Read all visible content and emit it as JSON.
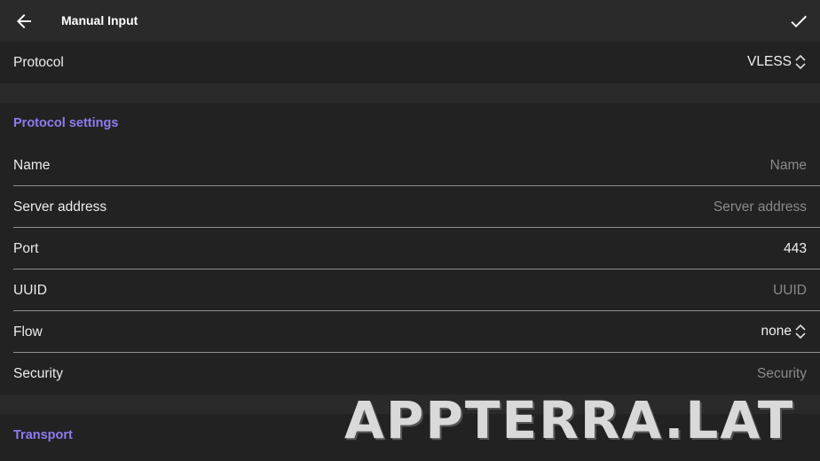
{
  "appbar": {
    "title": "Manual Input",
    "back_icon": "arrow-left-icon",
    "confirm_icon": "check-icon"
  },
  "protocol": {
    "label": "Protocol",
    "value": "VLESS"
  },
  "protocol_settings": {
    "title": "Protocol settings",
    "name": {
      "label": "Name",
      "placeholder": "Name"
    },
    "server_address": {
      "label": "Server address",
      "placeholder": "Server address"
    },
    "port": {
      "label": "Port",
      "value": "443"
    },
    "uuid": {
      "label": "UUID",
      "placeholder": "UUID"
    },
    "flow": {
      "label": "Flow",
      "value": "none"
    },
    "security": {
      "label": "Security",
      "placeholder": "Security"
    }
  },
  "transport": {
    "title": "Transport"
  },
  "watermark": "APPTERRA.LAT",
  "colors": {
    "accent": "#8d7cf0",
    "background": "#1b1b1b",
    "surface": "#222222",
    "appbar": "#2a2a2a"
  }
}
